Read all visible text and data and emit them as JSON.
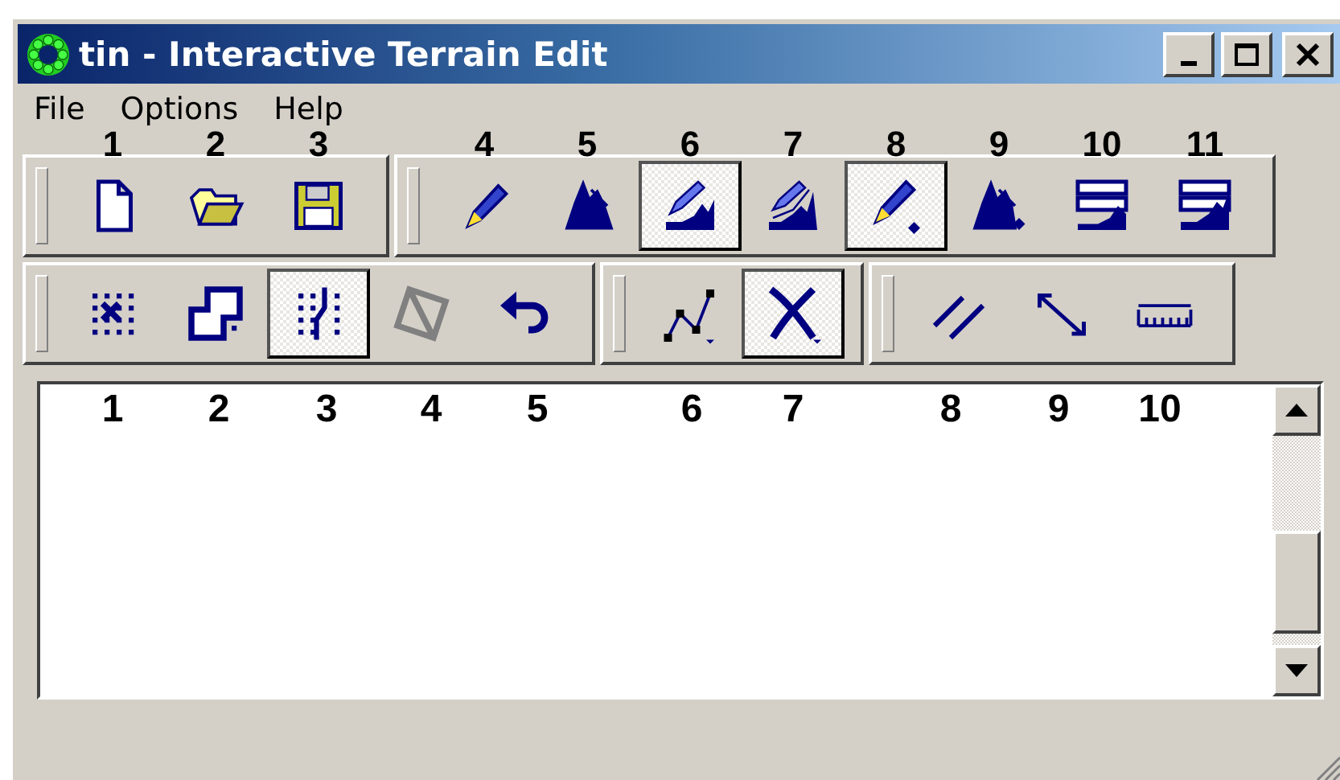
{
  "window": {
    "title": "tin - Interactive Terrain Edit"
  },
  "menu": [
    {
      "label": "File"
    },
    {
      "label": "Options"
    },
    {
      "label": "Help"
    }
  ],
  "toolbar_rows": [
    {
      "bands": [
        {
          "buttons": [
            {
              "callout": "1",
              "checked": false
            },
            {
              "callout": "2",
              "checked": false
            },
            {
              "callout": "3",
              "checked": false
            }
          ]
        },
        {
          "buttons": [
            {
              "callout": "4",
              "checked": false
            },
            {
              "callout": "5",
              "checked": false
            },
            {
              "callout": "6",
              "checked": true
            },
            {
              "callout": "7",
              "checked": false
            },
            {
              "callout": "8",
              "checked": true
            },
            {
              "callout": "9",
              "checked": false
            },
            {
              "callout": "10",
              "checked": false
            },
            {
              "callout": "11",
              "checked": false
            }
          ]
        }
      ]
    },
    {
      "bands": [
        {
          "buttons": [
            {
              "checked": false
            },
            {
              "checked": false
            },
            {
              "checked": true
            },
            {
              "checked": false
            },
            {
              "checked": false
            }
          ]
        },
        {
          "buttons": [
            {
              "checked": false
            },
            {
              "checked": true
            }
          ]
        },
        {
          "buttons": [
            {
              "checked": false
            },
            {
              "checked": false
            },
            {
              "checked": false
            }
          ]
        }
      ]
    }
  ],
  "text_area": {
    "callouts": [
      "1",
      "2",
      "3",
      "4",
      "5",
      "6",
      "7",
      "8",
      "9",
      "10"
    ]
  }
}
